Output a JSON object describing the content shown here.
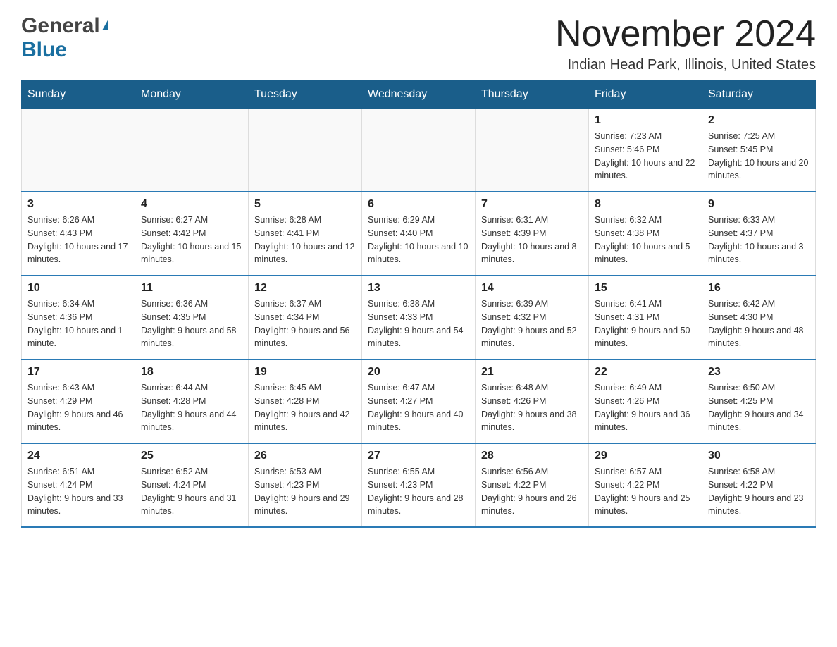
{
  "logo": {
    "general": "General",
    "blue": "Blue"
  },
  "title": "November 2024",
  "location": "Indian Head Park, Illinois, United States",
  "weekdays": [
    "Sunday",
    "Monday",
    "Tuesday",
    "Wednesday",
    "Thursday",
    "Friday",
    "Saturday"
  ],
  "weeks": [
    [
      {
        "day": "",
        "info": ""
      },
      {
        "day": "",
        "info": ""
      },
      {
        "day": "",
        "info": ""
      },
      {
        "day": "",
        "info": ""
      },
      {
        "day": "",
        "info": ""
      },
      {
        "day": "1",
        "info": "Sunrise: 7:23 AM\nSunset: 5:46 PM\nDaylight: 10 hours and 22 minutes."
      },
      {
        "day": "2",
        "info": "Sunrise: 7:25 AM\nSunset: 5:45 PM\nDaylight: 10 hours and 20 minutes."
      }
    ],
    [
      {
        "day": "3",
        "info": "Sunrise: 6:26 AM\nSunset: 4:43 PM\nDaylight: 10 hours and 17 minutes."
      },
      {
        "day": "4",
        "info": "Sunrise: 6:27 AM\nSunset: 4:42 PM\nDaylight: 10 hours and 15 minutes."
      },
      {
        "day": "5",
        "info": "Sunrise: 6:28 AM\nSunset: 4:41 PM\nDaylight: 10 hours and 12 minutes."
      },
      {
        "day": "6",
        "info": "Sunrise: 6:29 AM\nSunset: 4:40 PM\nDaylight: 10 hours and 10 minutes."
      },
      {
        "day": "7",
        "info": "Sunrise: 6:31 AM\nSunset: 4:39 PM\nDaylight: 10 hours and 8 minutes."
      },
      {
        "day": "8",
        "info": "Sunrise: 6:32 AM\nSunset: 4:38 PM\nDaylight: 10 hours and 5 minutes."
      },
      {
        "day": "9",
        "info": "Sunrise: 6:33 AM\nSunset: 4:37 PM\nDaylight: 10 hours and 3 minutes."
      }
    ],
    [
      {
        "day": "10",
        "info": "Sunrise: 6:34 AM\nSunset: 4:36 PM\nDaylight: 10 hours and 1 minute."
      },
      {
        "day": "11",
        "info": "Sunrise: 6:36 AM\nSunset: 4:35 PM\nDaylight: 9 hours and 58 minutes."
      },
      {
        "day": "12",
        "info": "Sunrise: 6:37 AM\nSunset: 4:34 PM\nDaylight: 9 hours and 56 minutes."
      },
      {
        "day": "13",
        "info": "Sunrise: 6:38 AM\nSunset: 4:33 PM\nDaylight: 9 hours and 54 minutes."
      },
      {
        "day": "14",
        "info": "Sunrise: 6:39 AM\nSunset: 4:32 PM\nDaylight: 9 hours and 52 minutes."
      },
      {
        "day": "15",
        "info": "Sunrise: 6:41 AM\nSunset: 4:31 PM\nDaylight: 9 hours and 50 minutes."
      },
      {
        "day": "16",
        "info": "Sunrise: 6:42 AM\nSunset: 4:30 PM\nDaylight: 9 hours and 48 minutes."
      }
    ],
    [
      {
        "day": "17",
        "info": "Sunrise: 6:43 AM\nSunset: 4:29 PM\nDaylight: 9 hours and 46 minutes."
      },
      {
        "day": "18",
        "info": "Sunrise: 6:44 AM\nSunset: 4:28 PM\nDaylight: 9 hours and 44 minutes."
      },
      {
        "day": "19",
        "info": "Sunrise: 6:45 AM\nSunset: 4:28 PM\nDaylight: 9 hours and 42 minutes."
      },
      {
        "day": "20",
        "info": "Sunrise: 6:47 AM\nSunset: 4:27 PM\nDaylight: 9 hours and 40 minutes."
      },
      {
        "day": "21",
        "info": "Sunrise: 6:48 AM\nSunset: 4:26 PM\nDaylight: 9 hours and 38 minutes."
      },
      {
        "day": "22",
        "info": "Sunrise: 6:49 AM\nSunset: 4:26 PM\nDaylight: 9 hours and 36 minutes."
      },
      {
        "day": "23",
        "info": "Sunrise: 6:50 AM\nSunset: 4:25 PM\nDaylight: 9 hours and 34 minutes."
      }
    ],
    [
      {
        "day": "24",
        "info": "Sunrise: 6:51 AM\nSunset: 4:24 PM\nDaylight: 9 hours and 33 minutes."
      },
      {
        "day": "25",
        "info": "Sunrise: 6:52 AM\nSunset: 4:24 PM\nDaylight: 9 hours and 31 minutes."
      },
      {
        "day": "26",
        "info": "Sunrise: 6:53 AM\nSunset: 4:23 PM\nDaylight: 9 hours and 29 minutes."
      },
      {
        "day": "27",
        "info": "Sunrise: 6:55 AM\nSunset: 4:23 PM\nDaylight: 9 hours and 28 minutes."
      },
      {
        "day": "28",
        "info": "Sunrise: 6:56 AM\nSunset: 4:22 PM\nDaylight: 9 hours and 26 minutes."
      },
      {
        "day": "29",
        "info": "Sunrise: 6:57 AM\nSunset: 4:22 PM\nDaylight: 9 hours and 25 minutes."
      },
      {
        "day": "30",
        "info": "Sunrise: 6:58 AM\nSunset: 4:22 PM\nDaylight: 9 hours and 23 minutes."
      }
    ]
  ],
  "colors": {
    "header_bg": "#1a5e8a",
    "header_text": "#ffffff",
    "border": "#2a7ab5"
  }
}
